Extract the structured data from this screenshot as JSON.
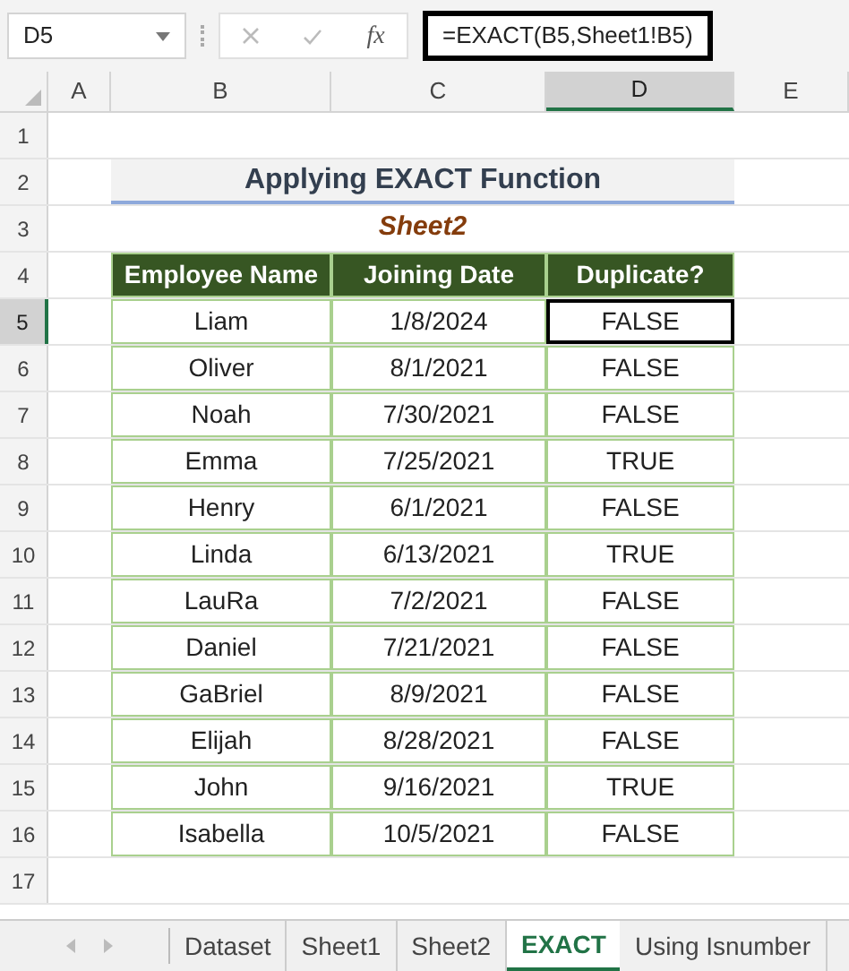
{
  "formula_bar": {
    "name_box": "D5",
    "fx": "fx",
    "formula": "=EXACT(B5,Sheet1!B5)"
  },
  "columns": [
    {
      "label": "A",
      "selected": false
    },
    {
      "label": "B",
      "selected": false
    },
    {
      "label": "C",
      "selected": false
    },
    {
      "label": "D",
      "selected": true
    },
    {
      "label": "E",
      "selected": false
    }
  ],
  "row_numbers": [
    {
      "label": "1",
      "selected": false
    },
    {
      "label": "2",
      "selected": false
    },
    {
      "label": "3",
      "selected": false
    },
    {
      "label": "4",
      "selected": false
    },
    {
      "label": "5",
      "selected": true
    },
    {
      "label": "6",
      "selected": false
    },
    {
      "label": "7",
      "selected": false
    },
    {
      "label": "8",
      "selected": false
    },
    {
      "label": "9",
      "selected": false
    },
    {
      "label": "10",
      "selected": false
    },
    {
      "label": "11",
      "selected": false
    },
    {
      "label": "12",
      "selected": false
    },
    {
      "label": "13",
      "selected": false
    },
    {
      "label": "14",
      "selected": false
    },
    {
      "label": "15",
      "selected": false
    },
    {
      "label": "16",
      "selected": false
    },
    {
      "label": "17",
      "selected": false
    }
  ],
  "title": "Applying EXACT Function",
  "subtitle": "Sheet2",
  "table": {
    "columns": [
      "Employee Name",
      "Joining Date",
      "Duplicate?"
    ],
    "rows": [
      {
        "name": "Liam",
        "date": "1/8/2024",
        "duplicate": "FALSE",
        "selected": true
      },
      {
        "name": "Oliver",
        "date": "8/1/2021",
        "duplicate": "FALSE",
        "selected": false
      },
      {
        "name": "Noah",
        "date": "7/30/2021",
        "duplicate": "FALSE",
        "selected": false
      },
      {
        "name": "Emma",
        "date": "7/25/2021",
        "duplicate": "TRUE",
        "selected": false
      },
      {
        "name": "Henry",
        "date": "6/1/2021",
        "duplicate": "FALSE",
        "selected": false
      },
      {
        "name": "Linda",
        "date": "6/13/2021",
        "duplicate": "TRUE",
        "selected": false
      },
      {
        "name": "LauRa",
        "date": "7/2/2021",
        "duplicate": "FALSE",
        "selected": false
      },
      {
        "name": "Daniel",
        "date": "7/21/2021",
        "duplicate": "FALSE",
        "selected": false
      },
      {
        "name": "GaBriel",
        "date": "8/9/2021",
        "duplicate": "FALSE",
        "selected": false
      },
      {
        "name": "Elijah",
        "date": "8/28/2021",
        "duplicate": "FALSE",
        "selected": false
      },
      {
        "name": "John",
        "date": "9/16/2021",
        "duplicate": "TRUE",
        "selected": false
      },
      {
        "name": "Isabella",
        "date": "10/5/2021",
        "duplicate": "FALSE",
        "selected": false
      }
    ]
  },
  "sheet_tabs": [
    {
      "label": "Dataset",
      "selected": false
    },
    {
      "label": "Sheet1",
      "selected": false
    },
    {
      "label": "Sheet2",
      "selected": false
    },
    {
      "label": "EXACT",
      "selected": true
    },
    {
      "label": "Using Isnumber",
      "selected": false
    }
  ]
}
